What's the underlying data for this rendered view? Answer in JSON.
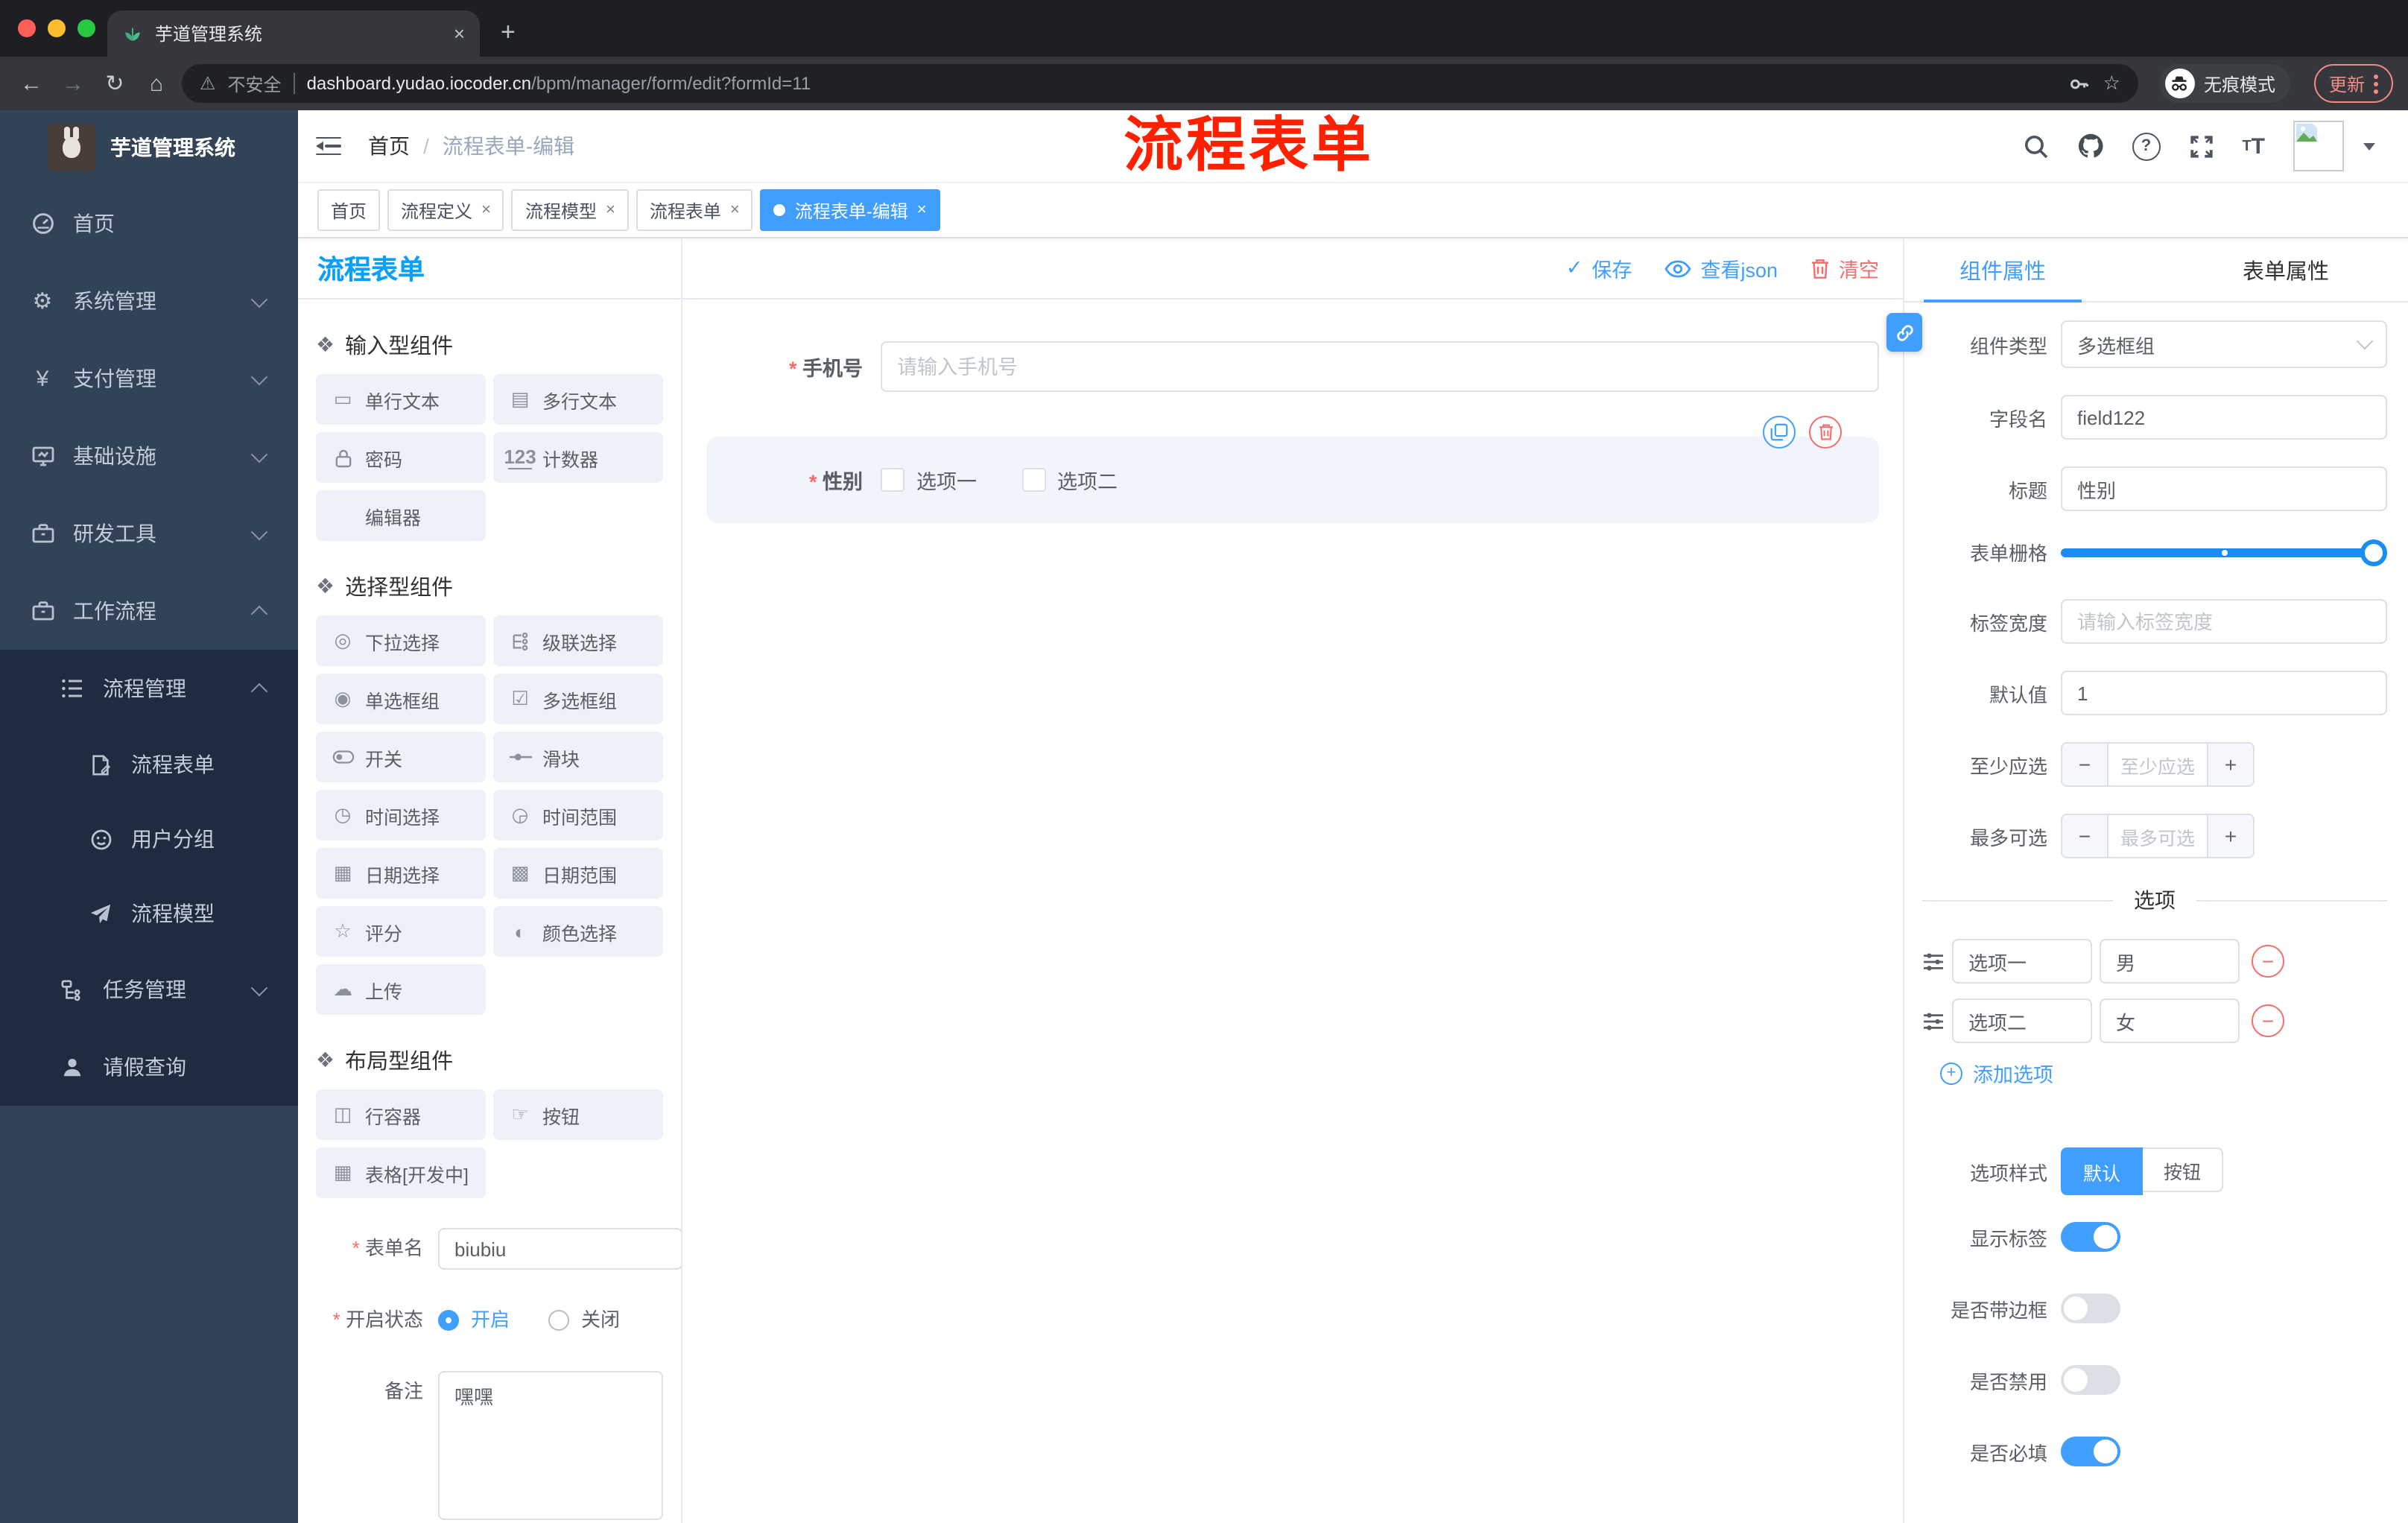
{
  "browser": {
    "tab_title": "芋道管理系统",
    "close_tab": "×",
    "new_tab": "+",
    "security_label": "不安全",
    "url_host": "dashboard.yudao.iocoder.cn",
    "url_path": "/bpm/manager/form/edit?formId=11",
    "incognito_label": "无痕模式",
    "update_label": "更新"
  },
  "sidebar": {
    "logo_title": "芋道管理系统",
    "items": [
      {
        "label": "首页"
      },
      {
        "label": "系统管理"
      },
      {
        "label": "支付管理"
      },
      {
        "label": "基础设施"
      },
      {
        "label": "研发工具"
      },
      {
        "label": "工作流程"
      },
      {
        "label": "流程管理"
      },
      {
        "label": "流程表单"
      },
      {
        "label": "用户分组"
      },
      {
        "label": "流程模型"
      },
      {
        "label": "任务管理"
      },
      {
        "label": "请假查询"
      }
    ]
  },
  "header": {
    "breadcrumb": [
      "首页",
      "流程表单-编辑"
    ],
    "separator": "/",
    "annotation": "流程表单",
    "annotation_color": "#ff2000"
  },
  "tags": [
    {
      "label": "首页"
    },
    {
      "label": "流程定义"
    },
    {
      "label": "流程模型"
    },
    {
      "label": "流程表单"
    },
    {
      "label": "流程表单-编辑"
    }
  ],
  "designer": {
    "panel_title": "流程表单",
    "sections": [
      {
        "title": "输入型组件",
        "items": [
          {
            "label": "单行文本"
          },
          {
            "label": "多行文本"
          },
          {
            "label": "密码"
          },
          {
            "label": "计数器"
          },
          {
            "label": "编辑器"
          }
        ]
      },
      {
        "title": "选择型组件",
        "items": [
          {
            "label": "下拉选择"
          },
          {
            "label": "级联选择"
          },
          {
            "label": "单选框组"
          },
          {
            "label": "多选框组"
          },
          {
            "label": "开关"
          },
          {
            "label": "滑块"
          },
          {
            "label": "时间选择"
          },
          {
            "label": "时间范围"
          },
          {
            "label": "日期选择"
          },
          {
            "label": "日期范围"
          },
          {
            "label": "评分"
          },
          {
            "label": "颜色选择"
          },
          {
            "label": "上传"
          }
        ]
      },
      {
        "title": "布局型组件",
        "items": [
          {
            "label": "行容器"
          },
          {
            "label": "按钮"
          },
          {
            "label": "表格[开发中]"
          }
        ]
      }
    ],
    "form": {
      "name_label": "表单名",
      "name_value": "biubiu",
      "status_label": "开启状态",
      "status_on": "开启",
      "status_off": "关闭",
      "remark_label": "备注",
      "remark_value": "嘿嘿"
    }
  },
  "canvas": {
    "save": "保存",
    "view_json": "查看json",
    "clear": "清空",
    "phone": {
      "label": "手机号",
      "placeholder": "请输入手机号"
    },
    "gender": {
      "label": "性别",
      "option1": "选项一",
      "option2": "选项二"
    }
  },
  "props": {
    "tab_component": "组件属性",
    "tab_form": "表单属性",
    "component_type_label": "组件类型",
    "component_type_value": "多选框组",
    "field_name_label": "字段名",
    "field_name_value": "field122",
    "title_label": "标题",
    "title_value": "性别",
    "grid_label": "表单栅格",
    "label_width_label": "标签宽度",
    "label_width_placeholder": "请输入标签宽度",
    "default_label": "默认值",
    "default_value": "1",
    "min_label": "至少应选",
    "min_placeholder": "至少应选",
    "max_label": "最多可选",
    "max_placeholder": "最多可选",
    "minus": "−",
    "plus": "+",
    "options_divider": "选项",
    "options": [
      {
        "label": "选项一",
        "value": "男"
      },
      {
        "label": "选项二",
        "value": "女"
      }
    ],
    "add_option": "添加选项",
    "style_label": "选项样式",
    "style_default": "默认",
    "style_button": "按钮",
    "switch_show_label": "显示标签",
    "switch_border": "是否带边框",
    "switch_disabled": "是否禁用",
    "switch_required": "是否必填"
  },
  "colors": {
    "accent": "#409eff",
    "danger": "#f56c6c",
    "panel_title_blue": "#0ba0f8",
    "sidebar_bg": "#324257",
    "submenu_bg": "#1f2c40",
    "selected_block_bg": "#f2f4fb"
  }
}
